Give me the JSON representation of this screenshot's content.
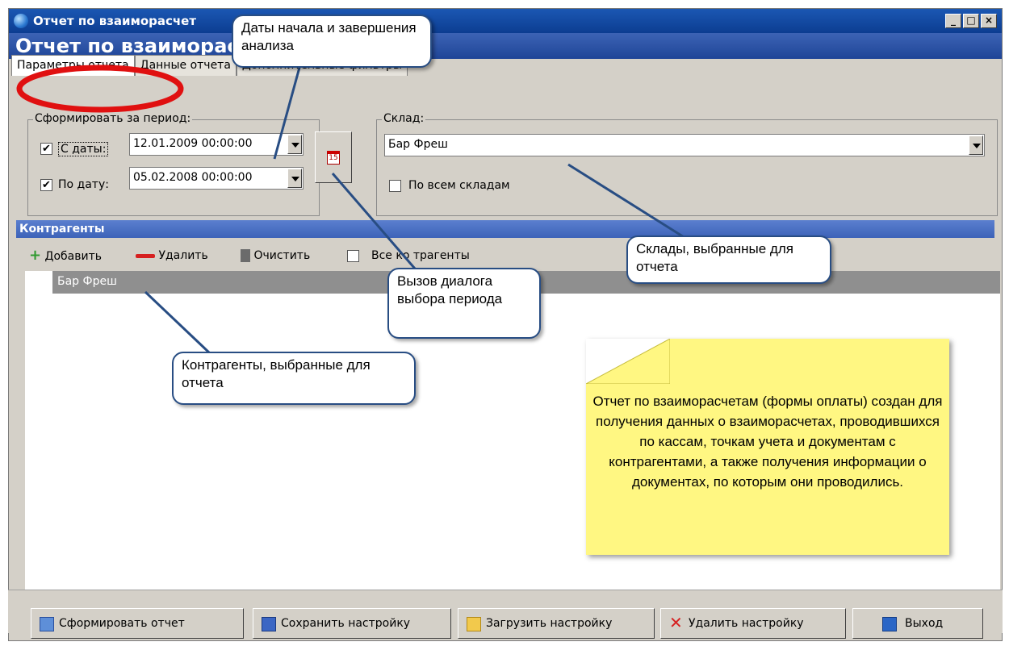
{
  "window": {
    "title": "Отчет по взаиморасчет",
    "header": "Отчет по взаиморасч                    платы)",
    "buttons": [
      "_",
      "□",
      "×"
    ]
  },
  "tabs": [
    {
      "label": "Параметры отчета",
      "active": true
    },
    {
      "label": "Данные отчета",
      "active": false
    },
    {
      "label": "Дополнительные фильтры",
      "active": false
    }
  ],
  "period": {
    "legend": "Сформировать за период:",
    "from_label": "С даты:",
    "from_value": "12.01.2009 00:00:00",
    "from_checked": true,
    "to_label": "По дату:",
    "to_value": "05.02.2008 00:00:00",
    "to_checked": true,
    "calendar_icon": "calendar-icon",
    "calendar_day": "15"
  },
  "warehouse": {
    "legend": "Склад:",
    "value": "Бар Фреш",
    "all_label": "По всем складам",
    "all_checked": false
  },
  "contractors": {
    "header": "Контрагенты",
    "add_label": "Добавить",
    "remove_label": "Удалить",
    "clear_label": "Очистить",
    "all_label": "Все ко трагенты",
    "rows": [
      "Бар Фреш"
    ]
  },
  "buttons": {
    "generate": "Сформировать отчет",
    "save": "Сохранить настройку",
    "load": "Загрузить настройку",
    "delete": "Удалить настройку",
    "exit": "Выход"
  },
  "callouts": {
    "dates": "Даты начала и завершения анализа",
    "warehouses": "Склады, выбранные для отчета",
    "period_dialog": "Вызов диалога выбора периода",
    "contractors": "Контрагенты, выбранные для отчета"
  },
  "note": "Отчет по взаиморасчетам (формы оплаты) создан для получения данных о взаиморасчетах, проводившихся по кассам, точкам учета и документам с контрагентами, а также получения информации о документах, по которым они проводились.",
  "colors": {
    "titlebar": "#0c3d91",
    "section_header": "#3d63b9",
    "note_bg": "#fff782",
    "highlight_ellipse": "#e01010",
    "callout_border": "#284d83"
  }
}
